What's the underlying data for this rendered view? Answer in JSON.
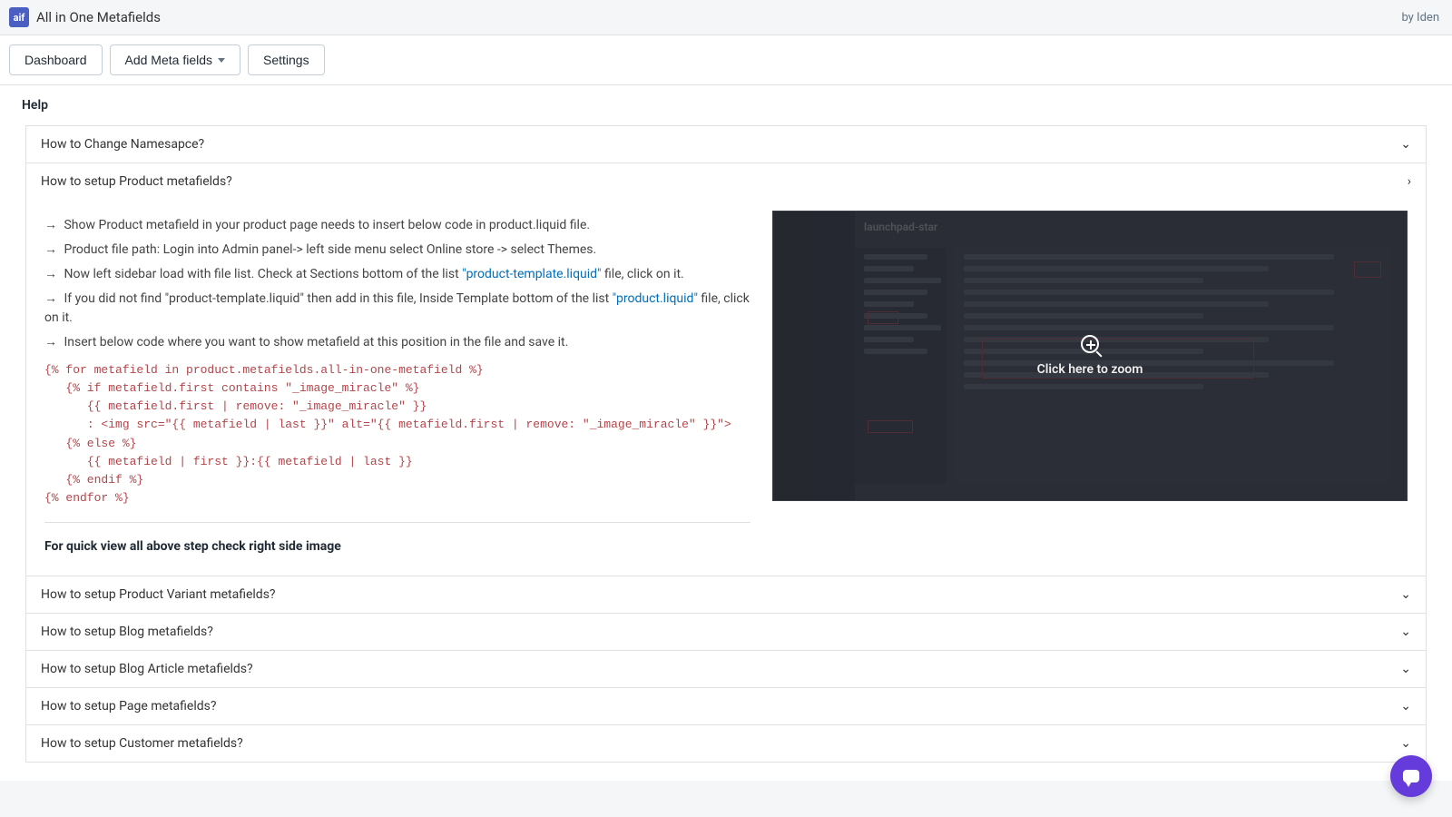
{
  "header": {
    "app_title": "All in One Metafields",
    "by_text": "by Iden"
  },
  "nav": {
    "dashboard": "Dashboard",
    "add_meta": "Add Meta fields",
    "settings": "Settings"
  },
  "page": {
    "title": "Help"
  },
  "accordion": [
    {
      "title": "How to Change Namesapce?",
      "expanded": false
    },
    {
      "title": "How to setup Product metafields?",
      "expanded": true
    },
    {
      "title": "How to setup Product Variant metafields?",
      "expanded": false
    },
    {
      "title": "How to setup Blog metafields?",
      "expanded": false
    },
    {
      "title": "How to setup Blog Article metafields?",
      "expanded": false
    },
    {
      "title": "How to setup Page metafields?",
      "expanded": false
    },
    {
      "title": "How to setup Customer metafields?",
      "expanded": false
    }
  ],
  "product_help": {
    "steps": [
      {
        "prefix": "→",
        "text": "Show Product metafield in your product page needs to insert below code in product.liquid file."
      },
      {
        "prefix": "→",
        "text": "Product file path: Login into Admin panel-> left side menu select Online store -> select Themes."
      },
      {
        "prefix": "→",
        "text_pre": "Now left sidebar load with file list. Check at Sections bottom of the list ",
        "link": "\"product-template.liquid\"",
        "text_post": " file, click on it."
      },
      {
        "prefix": "→",
        "text_pre": "If you did not find \"product-template.liquid\" then add in this file, Inside Template bottom of the list ",
        "link": "\"product.liquid\"",
        "text_post": " file, click on it."
      },
      {
        "prefix": "→",
        "text": "Insert below code where you want to show metafield at this position in the file and save it."
      }
    ],
    "code": "{% for metafield in product.metafields.all-in-one-metafield %}\n   {% if metafield.first contains \"_image_miracle\" %}\n      {{ metafield.first | remove: \"_image_miracle\" }}\n      : <img src=\"{{ metafield | last }}\" alt=\"{{ metafield.first | remove: \"_image_miracle\" }}\">\n   {% else %}\n      {{ metafield | first }}:{{ metafield | last }}\n   {% endif %}\n{% endfor %}",
    "note": "For quick view all above step check right side image",
    "zoom_label": "Click here to zoom",
    "mock_title": "launchpad-star"
  }
}
